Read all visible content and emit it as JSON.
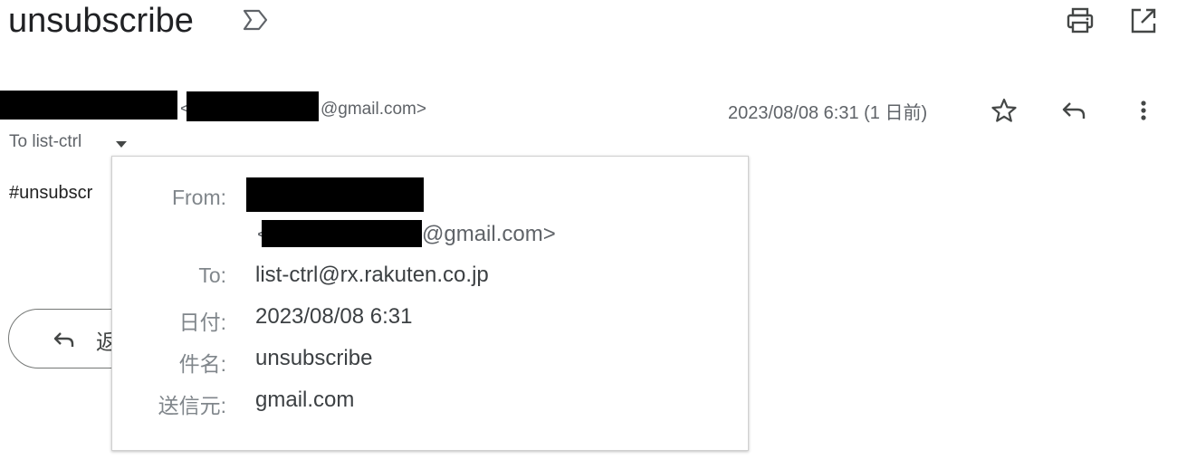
{
  "subject": "unsubscribe",
  "toolbar": {
    "label_icon": "label-important-outline-icon",
    "print_icon": "print-icon",
    "new_window_icon": "open-in-new-icon"
  },
  "sender": {
    "address_open": "<",
    "address_domain": "@gmail.com>"
  },
  "date_text": "2023/08/08 6:31 (1 日前)",
  "actions": {
    "star_icon": "star-outline-icon",
    "reply_icon": "reply-icon",
    "more_icon": "more-vert-icon"
  },
  "to_line": "To list-ctrl",
  "body_preview": "#unsubscr",
  "reply_button": {
    "label": "返"
  },
  "details_popup": {
    "rows": [
      {
        "label": "From:",
        "value": ""
      },
      {
        "label": "",
        "value_prefix": "<",
        "value": "@gmail.com>"
      },
      {
        "label": "To:",
        "value": "list-ctrl@rx.rakuten.co.jp"
      },
      {
        "label": "日付:",
        "value": "2023/08/08 6:31"
      },
      {
        "label": "件名:",
        "value": "unsubscribe"
      },
      {
        "label": "送信元:",
        "value": "gmail.com"
      }
    ]
  },
  "colors": {
    "text_primary": "#202124",
    "text_secondary": "#5f6368",
    "label_gray": "#80868b",
    "redaction": "#000000"
  }
}
